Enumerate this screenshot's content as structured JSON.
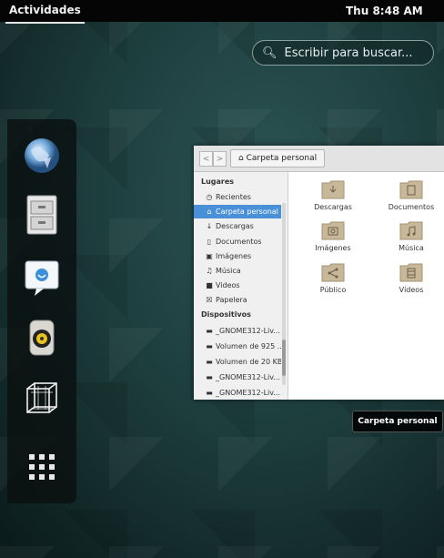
{
  "topbar": {
    "activities_label": "Actividades",
    "clock": "Thu  8:48 AM"
  },
  "search": {
    "placeholder": "Escribir para buscar..."
  },
  "dash": {
    "items": [
      "web-browser-icon",
      "file-manager-icon",
      "chat-icon",
      "audio-player-icon",
      "3d-cube-icon",
      "app-grid-icon"
    ]
  },
  "window": {
    "breadcrumb": "Carpeta personal",
    "sidebar": {
      "places_header": "Lugares",
      "places": [
        "Recientes",
        "Carpeta personal",
        "Descargas",
        "Documentos",
        "Imágenes",
        "Música",
        "Videos",
        "Papelera"
      ],
      "devices_header": "Dispositivos",
      "devices": [
        "_GNOME312-Liv...",
        "Volumen de 925 ...",
        "Volumen de 20 KB",
        "_GNOME312-Liv...",
        "_GNOME312-Liv..."
      ]
    },
    "folders": [
      "Descargas",
      "Documentos",
      "Imágenes",
      "Música",
      "Público",
      "Vídeos"
    ]
  },
  "tooltip": "Carpeta personal",
  "colors": {
    "topbar": "#050505",
    "selection": "#4a90d9",
    "folder": "#c8b89a"
  }
}
